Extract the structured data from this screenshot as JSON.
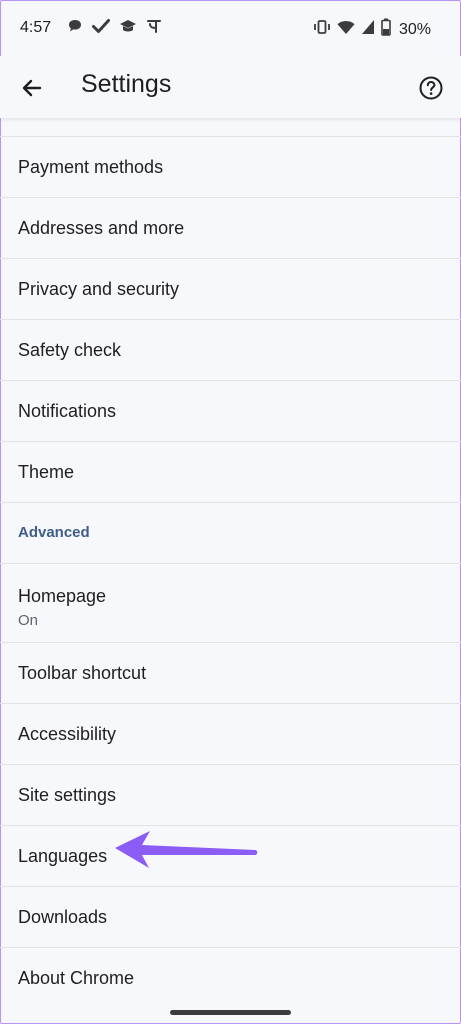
{
  "status_bar": {
    "time": "4:57",
    "left_icons": [
      "chat-bubble-icon",
      "check-icon",
      "graduation-cap-icon",
      "paytm-icon"
    ],
    "right_icons": [
      "vibrate-icon",
      "wifi-icon",
      "signal-icon",
      "battery-icon"
    ],
    "battery": "30%"
  },
  "app_bar": {
    "title": "Settings",
    "back_icon": "arrow-back-icon",
    "help_icon": "help-icon"
  },
  "settings": [
    {
      "label": "Payment methods"
    },
    {
      "label": "Addresses and more"
    },
    {
      "label": "Privacy and security"
    },
    {
      "label": "Safety check"
    },
    {
      "label": "Notifications"
    },
    {
      "label": "Theme"
    }
  ],
  "advanced": {
    "header": "Advanced",
    "homepage": {
      "label": "Homepage",
      "sub": "On"
    },
    "items": [
      {
        "label": "Toolbar shortcut"
      },
      {
        "label": "Accessibility"
      },
      {
        "label": "Site settings"
      },
      {
        "label": "Languages"
      },
      {
        "label": "Downloads"
      },
      {
        "label": "About Chrome"
      }
    ]
  },
  "annotation": {
    "color": "#8b5cf6",
    "points_to": "Languages"
  }
}
